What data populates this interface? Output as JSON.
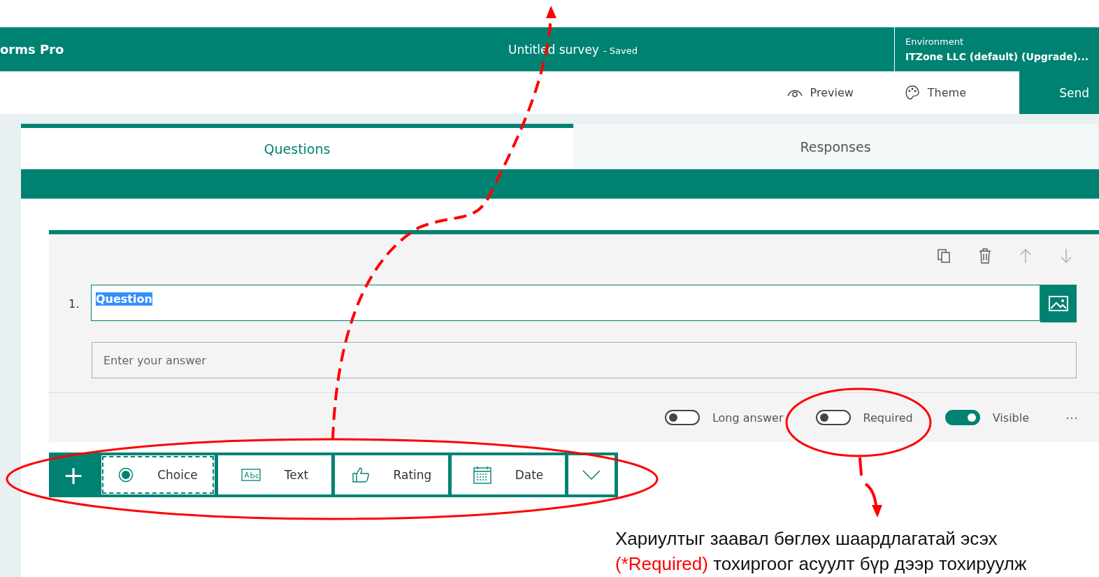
{
  "header": {
    "app_title": "orms Pro",
    "survey_title": "Untitled survey",
    "save_status": "- Saved",
    "environment_label": "Environment",
    "environment_name": "ITZone LLC (default) (Upgrade)..."
  },
  "toolbar": {
    "actions": [
      {
        "label": "Preview",
        "kind": "eye"
      },
      {
        "label": "Theme",
        "kind": "palette"
      }
    ],
    "send_label": "Send"
  },
  "tabs": [
    {
      "label": "Questions",
      "selected": true
    },
    {
      "label": "Responses",
      "selected": false
    }
  ],
  "question": {
    "number": "1.",
    "title": "Question",
    "title_selected": true,
    "answer_placeholder": "Enter your answer",
    "more_label": "···",
    "toggles": [
      {
        "label": "Long answer",
        "on": false
      },
      {
        "label": "Required",
        "on": false
      },
      {
        "label": "Visible",
        "on": true
      }
    ]
  },
  "add_bar": {
    "add_label": "+",
    "items": [
      {
        "label": "Choice",
        "kind": "choice",
        "selected": true
      },
      {
        "label": "Text",
        "kind": "text",
        "selected": false
      },
      {
        "label": "Rating",
        "kind": "rating",
        "selected": false
      },
      {
        "label": "Date",
        "kind": "date",
        "selected": false
      }
    ]
  },
  "annotation": {
    "caption_line_1": "Хариултыг заавал бөглөх шаардлагатай эсэх",
    "caption_highlight": "(*Required)",
    "caption_rest": "тохиргоог асуулт бүр дээр тохируулж"
  }
}
